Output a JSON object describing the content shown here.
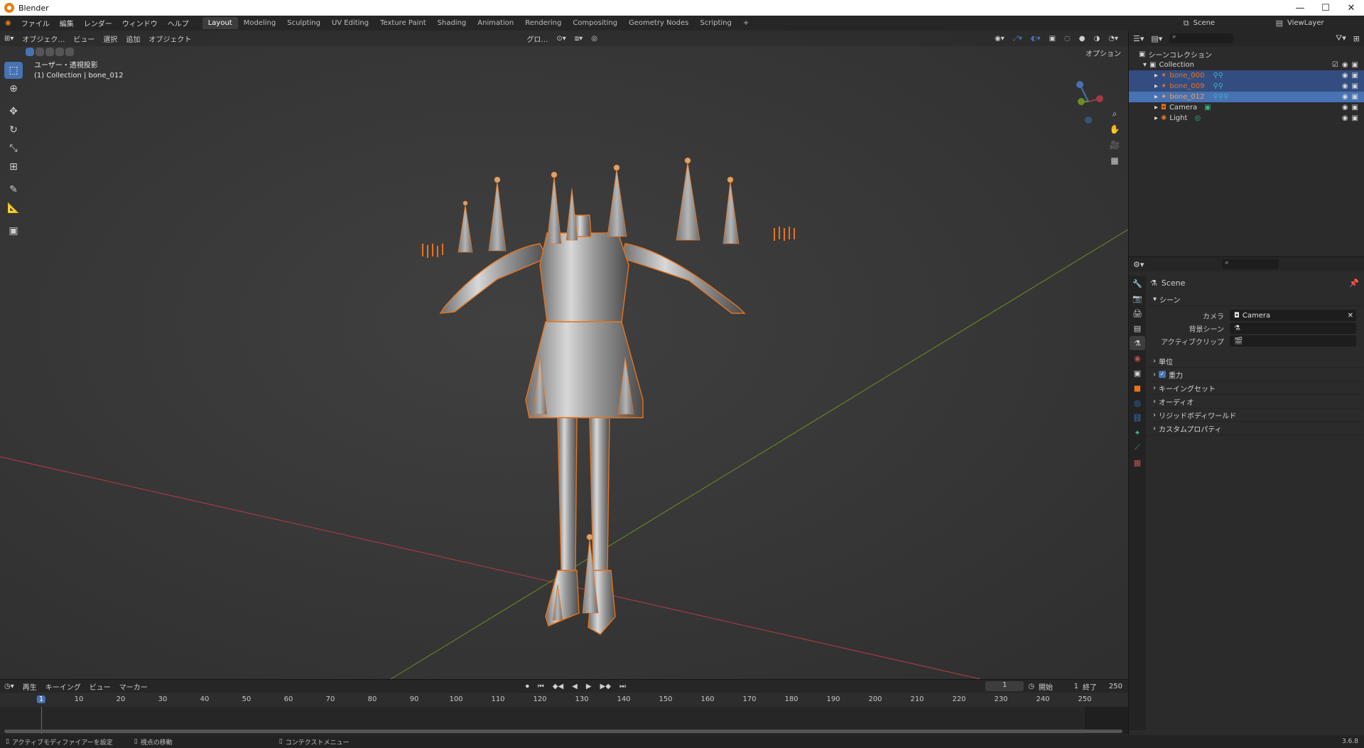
{
  "window": {
    "title": "Blender",
    "controls": [
      "—",
      "☐",
      "✕"
    ]
  },
  "menus": [
    "ファイル",
    "編集",
    "レンダー",
    "ウィンドウ",
    "ヘルプ"
  ],
  "workspaces": [
    "Layout",
    "Modeling",
    "Sculpting",
    "UV Editing",
    "Texture Paint",
    "Shading",
    "Animation",
    "Rendering",
    "Compositing",
    "Geometry Nodes",
    "Scripting"
  ],
  "active_workspace": "Layout",
  "add_workspace": "+",
  "scene_selector": {
    "scene": "Scene",
    "view_layer": "ViewLayer"
  },
  "viewport": {
    "mode": "オブジェク…",
    "menus": [
      "ビュー",
      "選択",
      "追加",
      "オブジェクト"
    ],
    "transform_orientation": "グロ…",
    "options": "オプション",
    "info_line1": "ユーザー・透視投影",
    "info_line2": "(1) Collection | bone_012"
  },
  "outliner": {
    "root": "シーンコレクション",
    "collection": "Collection",
    "items": [
      {
        "name": "bone_000",
        "selected": true
      },
      {
        "name": "bone_009",
        "selected": true
      },
      {
        "name": "bone_012",
        "selected": true
      },
      {
        "name": "Camera",
        "selected": false
      },
      {
        "name": "Light",
        "selected": false
      }
    ]
  },
  "properties": {
    "header": "Scene",
    "panel": "シーン",
    "fields": [
      {
        "label": "カメラ",
        "value": "Camera"
      },
      {
        "label": "背景シーン",
        "value": ""
      },
      {
        "label": "アクティブクリップ",
        "value": ""
      }
    ],
    "sections": [
      "単位",
      "重力",
      "キーイングセット",
      "オーディオ",
      "リジッドボディワールド",
      "カスタムプロパティ"
    ],
    "gravity_checked": true
  },
  "timeline": {
    "menus": [
      "再生",
      "キーイング",
      "ビュー",
      "マーカー"
    ],
    "current_frame": "1",
    "start_label": "開始",
    "start": "1",
    "end_label": "終了",
    "end": "250",
    "ticks": [
      "1",
      "10",
      "20",
      "30",
      "40",
      "50",
      "60",
      "70",
      "80",
      "90",
      "100",
      "110",
      "120",
      "130",
      "140",
      "150",
      "160",
      "170",
      "180",
      "190",
      "200",
      "210",
      "220",
      "230",
      "240",
      "250"
    ]
  },
  "status": {
    "left": "アクティブモディファイアーを設定",
    "mid": "視点の移動",
    "right": "コンテクストメニュー",
    "version": "3.6.8"
  },
  "colors": {
    "accent": "#4772b3",
    "selection": "#e87d0d",
    "x_axis": "#a33a44",
    "y_axis": "#6b8e23"
  }
}
